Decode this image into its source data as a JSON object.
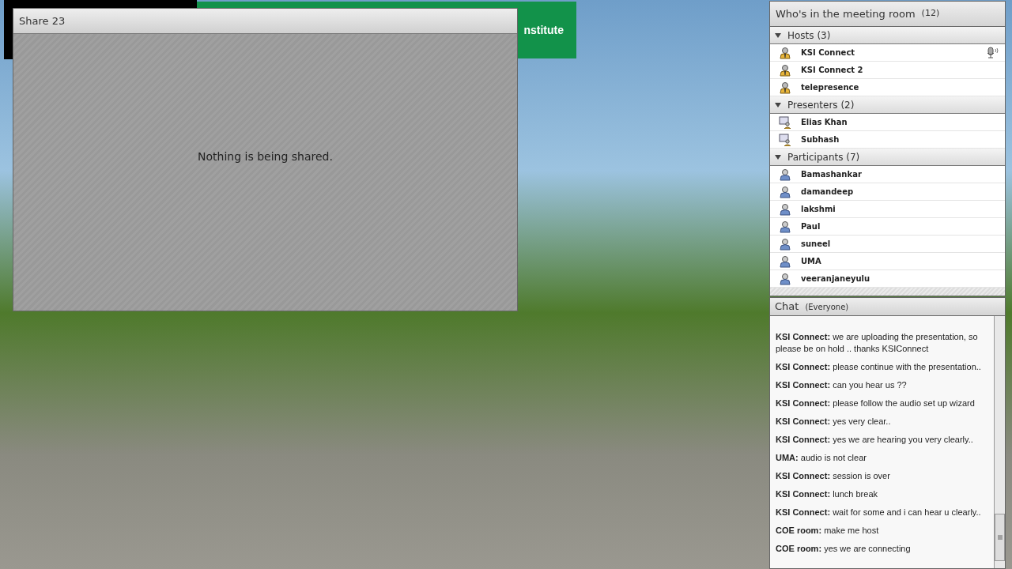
{
  "banner": {
    "text": "nstitute"
  },
  "share_pod": {
    "title": "Share 23",
    "message": "Nothing is being shared."
  },
  "attendees_pod": {
    "title": "Who's in the meeting room",
    "count": "(12)",
    "sections": [
      {
        "label": "Hosts (3)",
        "kind": "host",
        "expanded": true,
        "members": [
          {
            "name": "KSI Connect",
            "speaking": true
          },
          {
            "name": "KSI Connect 2",
            "speaking": false
          },
          {
            "name": "telepresence",
            "speaking": false
          }
        ]
      },
      {
        "label": "Presenters (2)",
        "kind": "presenter",
        "expanded": true,
        "members": [
          {
            "name": "Elias Khan",
            "speaking": false
          },
          {
            "name": "Subhash",
            "speaking": false
          }
        ]
      },
      {
        "label": "Participants (7)",
        "kind": "participant",
        "expanded": true,
        "members": [
          {
            "name": "Bamashankar",
            "speaking": false
          },
          {
            "name": "damandeep",
            "speaking": false
          },
          {
            "name": "lakshmi",
            "speaking": false
          },
          {
            "name": "Paul",
            "speaking": false
          },
          {
            "name": "suneel",
            "speaking": false
          },
          {
            "name": "UMA",
            "speaking": false
          },
          {
            "name": "veeranjaneyulu",
            "speaking": false
          }
        ]
      }
    ]
  },
  "chat_pod": {
    "title": "Chat",
    "audience": "(Everyone)",
    "messages": [
      {
        "sender": "KSI Connect:",
        "text": "we are uploading the presentation, so please be on hold .. thanks KSIConnect"
      },
      {
        "sender": "KSI Connect:",
        "text": "please continue with the presentation.."
      },
      {
        "sender": "KSI Connect:",
        "text": "can you hear us ??"
      },
      {
        "sender": "KSI Connect:",
        "text": "please follow the audio set up wizard"
      },
      {
        "sender": "KSI Connect:",
        "text": "yes very clear.."
      },
      {
        "sender": "KSI Connect:",
        "text": "yes we are hearing you very clearly.."
      },
      {
        "sender": "UMA:",
        "text": "audio is not clear"
      },
      {
        "sender": "KSI Connect:",
        "text": "session is over"
      },
      {
        "sender": "KSI Connect:",
        "text": "lunch break"
      },
      {
        "sender": "KSI Connect:",
        "text": "wait for some and i can hear u clearly.."
      },
      {
        "sender": "COE room:",
        "text": "make me host"
      },
      {
        "sender": "COE room:",
        "text": "yes we are connecting"
      }
    ]
  }
}
